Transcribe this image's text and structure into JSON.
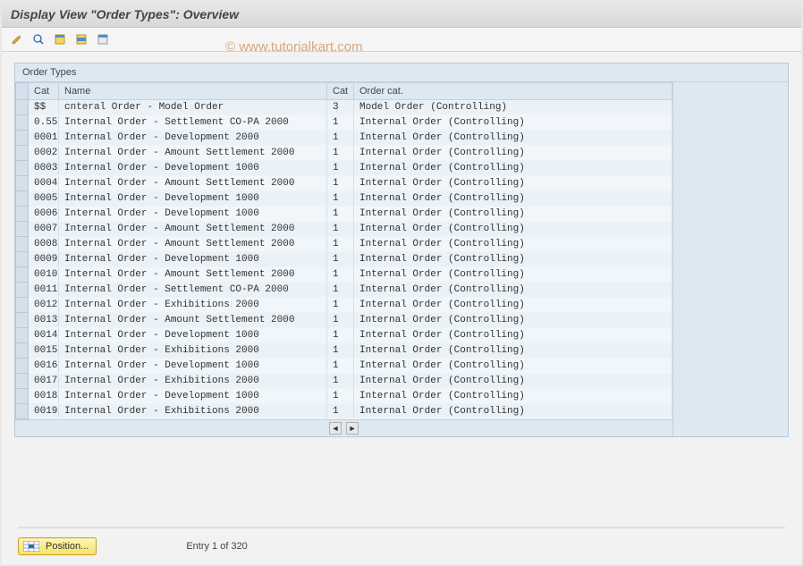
{
  "title": "Display View \"Order Types\": Overview",
  "watermark": "© www.tutorialkart.com",
  "panel_title": "Order Types",
  "columns": {
    "sel": "",
    "cat1": "Cat",
    "name": "Name",
    "cat2": "Cat",
    "ordercat": "Order cat."
  },
  "rows": [
    {
      "cat1": "$$",
      "name": "cnteral Order - Model Order",
      "cat2": "3",
      "ordercat": "Model Order (Controlling)"
    },
    {
      "cat1": "0.55",
      "name": "Internal Order - Settlement CO-PA   2000",
      "cat2": "1",
      "ordercat": "Internal Order (Controlling)"
    },
    {
      "cat1": "0001",
      "name": "Internal Order - Development        2000",
      "cat2": "1",
      "ordercat": "Internal Order (Controlling)"
    },
    {
      "cat1": "0002",
      "name": "Internal Order - Amount Settlement  2000",
      "cat2": "1",
      "ordercat": "Internal Order (Controlling)"
    },
    {
      "cat1": "0003",
      "name": "Internal Order - Development        1000",
      "cat2": "1",
      "ordercat": "Internal Order (Controlling)"
    },
    {
      "cat1": "0004",
      "name": "Internal Order - Amount Settlement  2000",
      "cat2": "1",
      "ordercat": "Internal Order (Controlling)"
    },
    {
      "cat1": "0005",
      "name": "Internal Order - Development        1000",
      "cat2": "1",
      "ordercat": "Internal Order (Controlling)"
    },
    {
      "cat1": "0006",
      "name": "Internal Order - Development        1000",
      "cat2": "1",
      "ordercat": "Internal Order (Controlling)"
    },
    {
      "cat1": "0007",
      "name": "Internal Order - Amount Settlement  2000",
      "cat2": "1",
      "ordercat": "Internal Order (Controlling)"
    },
    {
      "cat1": "0008",
      "name": "Internal Order - Amount Settlement  2000",
      "cat2": "1",
      "ordercat": "Internal Order (Controlling)"
    },
    {
      "cat1": "0009",
      "name": "Internal Order - Development        1000",
      "cat2": "1",
      "ordercat": "Internal Order (Controlling)"
    },
    {
      "cat1": "0010",
      "name": "Internal Order - Amount Settlement  2000",
      "cat2": "1",
      "ordercat": "Internal Order (Controlling)"
    },
    {
      "cat1": "0011",
      "name": "Internal Order - Settlement CO-PA   2000",
      "cat2": "1",
      "ordercat": "Internal Order (Controlling)"
    },
    {
      "cat1": "0012",
      "name": "Internal Order - Exhibitions        2000",
      "cat2": "1",
      "ordercat": "Internal Order (Controlling)"
    },
    {
      "cat1": "0013",
      "name": "Internal Order - Amount Settlement  2000",
      "cat2": "1",
      "ordercat": "Internal Order (Controlling)"
    },
    {
      "cat1": "0014",
      "name": "Internal Order - Development        1000",
      "cat2": "1",
      "ordercat": "Internal Order (Controlling)"
    },
    {
      "cat1": "0015",
      "name": "Internal Order - Exhibitions        2000",
      "cat2": "1",
      "ordercat": "Internal Order (Controlling)"
    },
    {
      "cat1": "0016",
      "name": "Internal Order - Development        1000",
      "cat2": "1",
      "ordercat": "Internal Order (Controlling)"
    },
    {
      "cat1": "0017",
      "name": "Internal Order - Exhibitions        2000",
      "cat2": "1",
      "ordercat": "Internal Order (Controlling)"
    },
    {
      "cat1": "0018",
      "name": "Internal Order - Development        1000",
      "cat2": "1",
      "ordercat": "Internal Order (Controlling)"
    },
    {
      "cat1": "0019",
      "name": "Internal Order - Exhibitions        2000",
      "cat2": "1",
      "ordercat": "Internal Order (Controlling)"
    }
  ],
  "footer": {
    "position_label": "Position...",
    "entry_label": "Entry 1 of 320"
  },
  "icons": {
    "change": "change-icon",
    "detail": "detail-icon",
    "select_all": "select-all-icon",
    "select_block": "select-block-icon",
    "deselect": "deselect-icon"
  }
}
